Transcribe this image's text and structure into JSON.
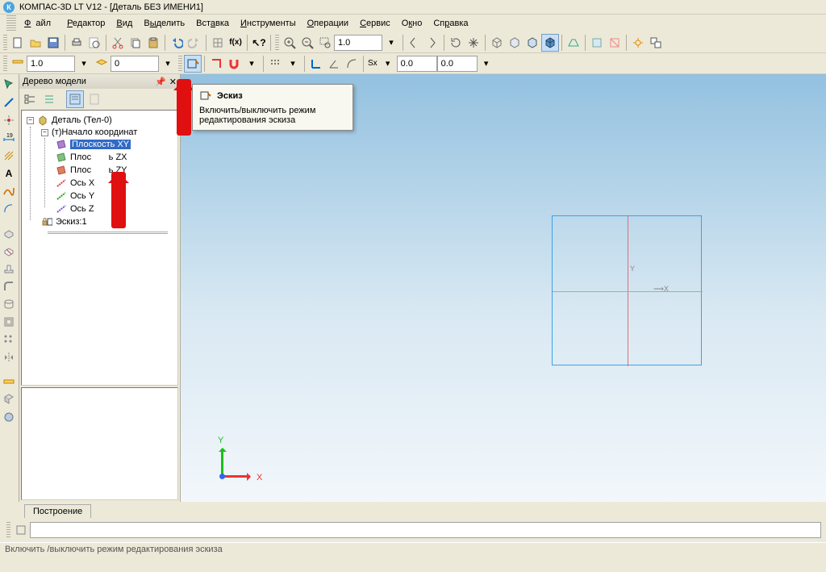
{
  "title": "КОМПАС-3D LT V12 - [Деталь БЕЗ ИМЕНИ1]",
  "menu": {
    "file": "Файл",
    "editor": "Редактор",
    "view": "Вид",
    "select": "Выделить",
    "insert": "Вставка",
    "instruments": "Инструменты",
    "operations": "Операции",
    "service": "Сервис",
    "window": "Окно",
    "help": "Справка"
  },
  "toolbar2": {
    "scale": "1.0",
    "stepper": "0",
    "zoom": "1.0",
    "x": "0.0",
    "y": "0.0",
    "sx_label": "Sx"
  },
  "tree": {
    "header": "Дерево модели",
    "root": "Деталь (Тел-0)",
    "origin": "(т)Начало координат",
    "plane_xy": "Плоскость XY",
    "plane_zx": "Плоскость ZX",
    "plane_zy": "Плоскость ZY",
    "axis_x": "Ось X",
    "axis_y": "Ось Y",
    "axis_z": "Ось Z",
    "sketch": "Эскиз:1",
    "plane_partial_l": "Плос",
    "plane_partial_r_zx": "ь ZX",
    "plane_partial_r_zy": "ь ZY"
  },
  "tooltip": {
    "title": "Эскиз",
    "body": "Включить/выключить режим редактирования эскиза"
  },
  "viewport": {
    "x_label": "X",
    "y_label": "Y"
  },
  "tabs": {
    "build": "Построение"
  },
  "status": "Включить /выключить режим редактирования эскиза"
}
